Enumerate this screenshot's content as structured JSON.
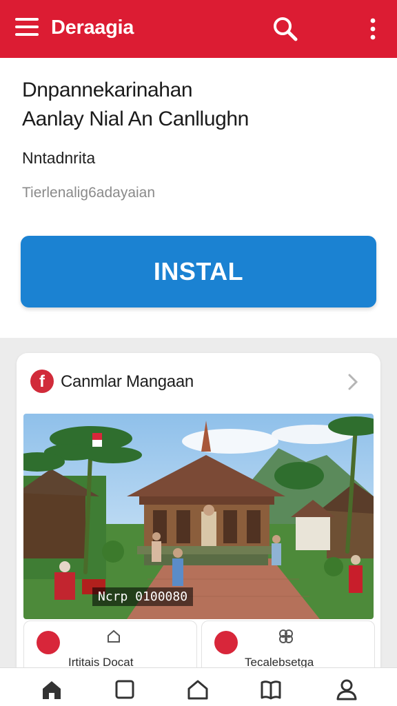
{
  "app": {
    "title": "Deraagia"
  },
  "hero": {
    "line1": "Dnpannekarinahan",
    "line2": "Aanlay Nial An Canllughn",
    "subtitle": "Nntadnrita",
    "hint": "Tierlenalig6adayaian",
    "install_label": "INSTAL"
  },
  "card": {
    "title": "Canmlar Mangaan",
    "image_caption": "Ncrp 0100080",
    "mini_left_label": "Irtitais Docat",
    "mini_right_label": "Tecalebsetga"
  },
  "colors": {
    "brand_red": "#dc1c33",
    "install_blue": "#1b82d2"
  },
  "icons": [
    "menu-icon",
    "search-icon",
    "kebab-menu-icon",
    "facebook-icon",
    "chevron-right-icon",
    "home-icon",
    "square-icon",
    "house-outline-icon",
    "book-icon",
    "profile-icon"
  ]
}
